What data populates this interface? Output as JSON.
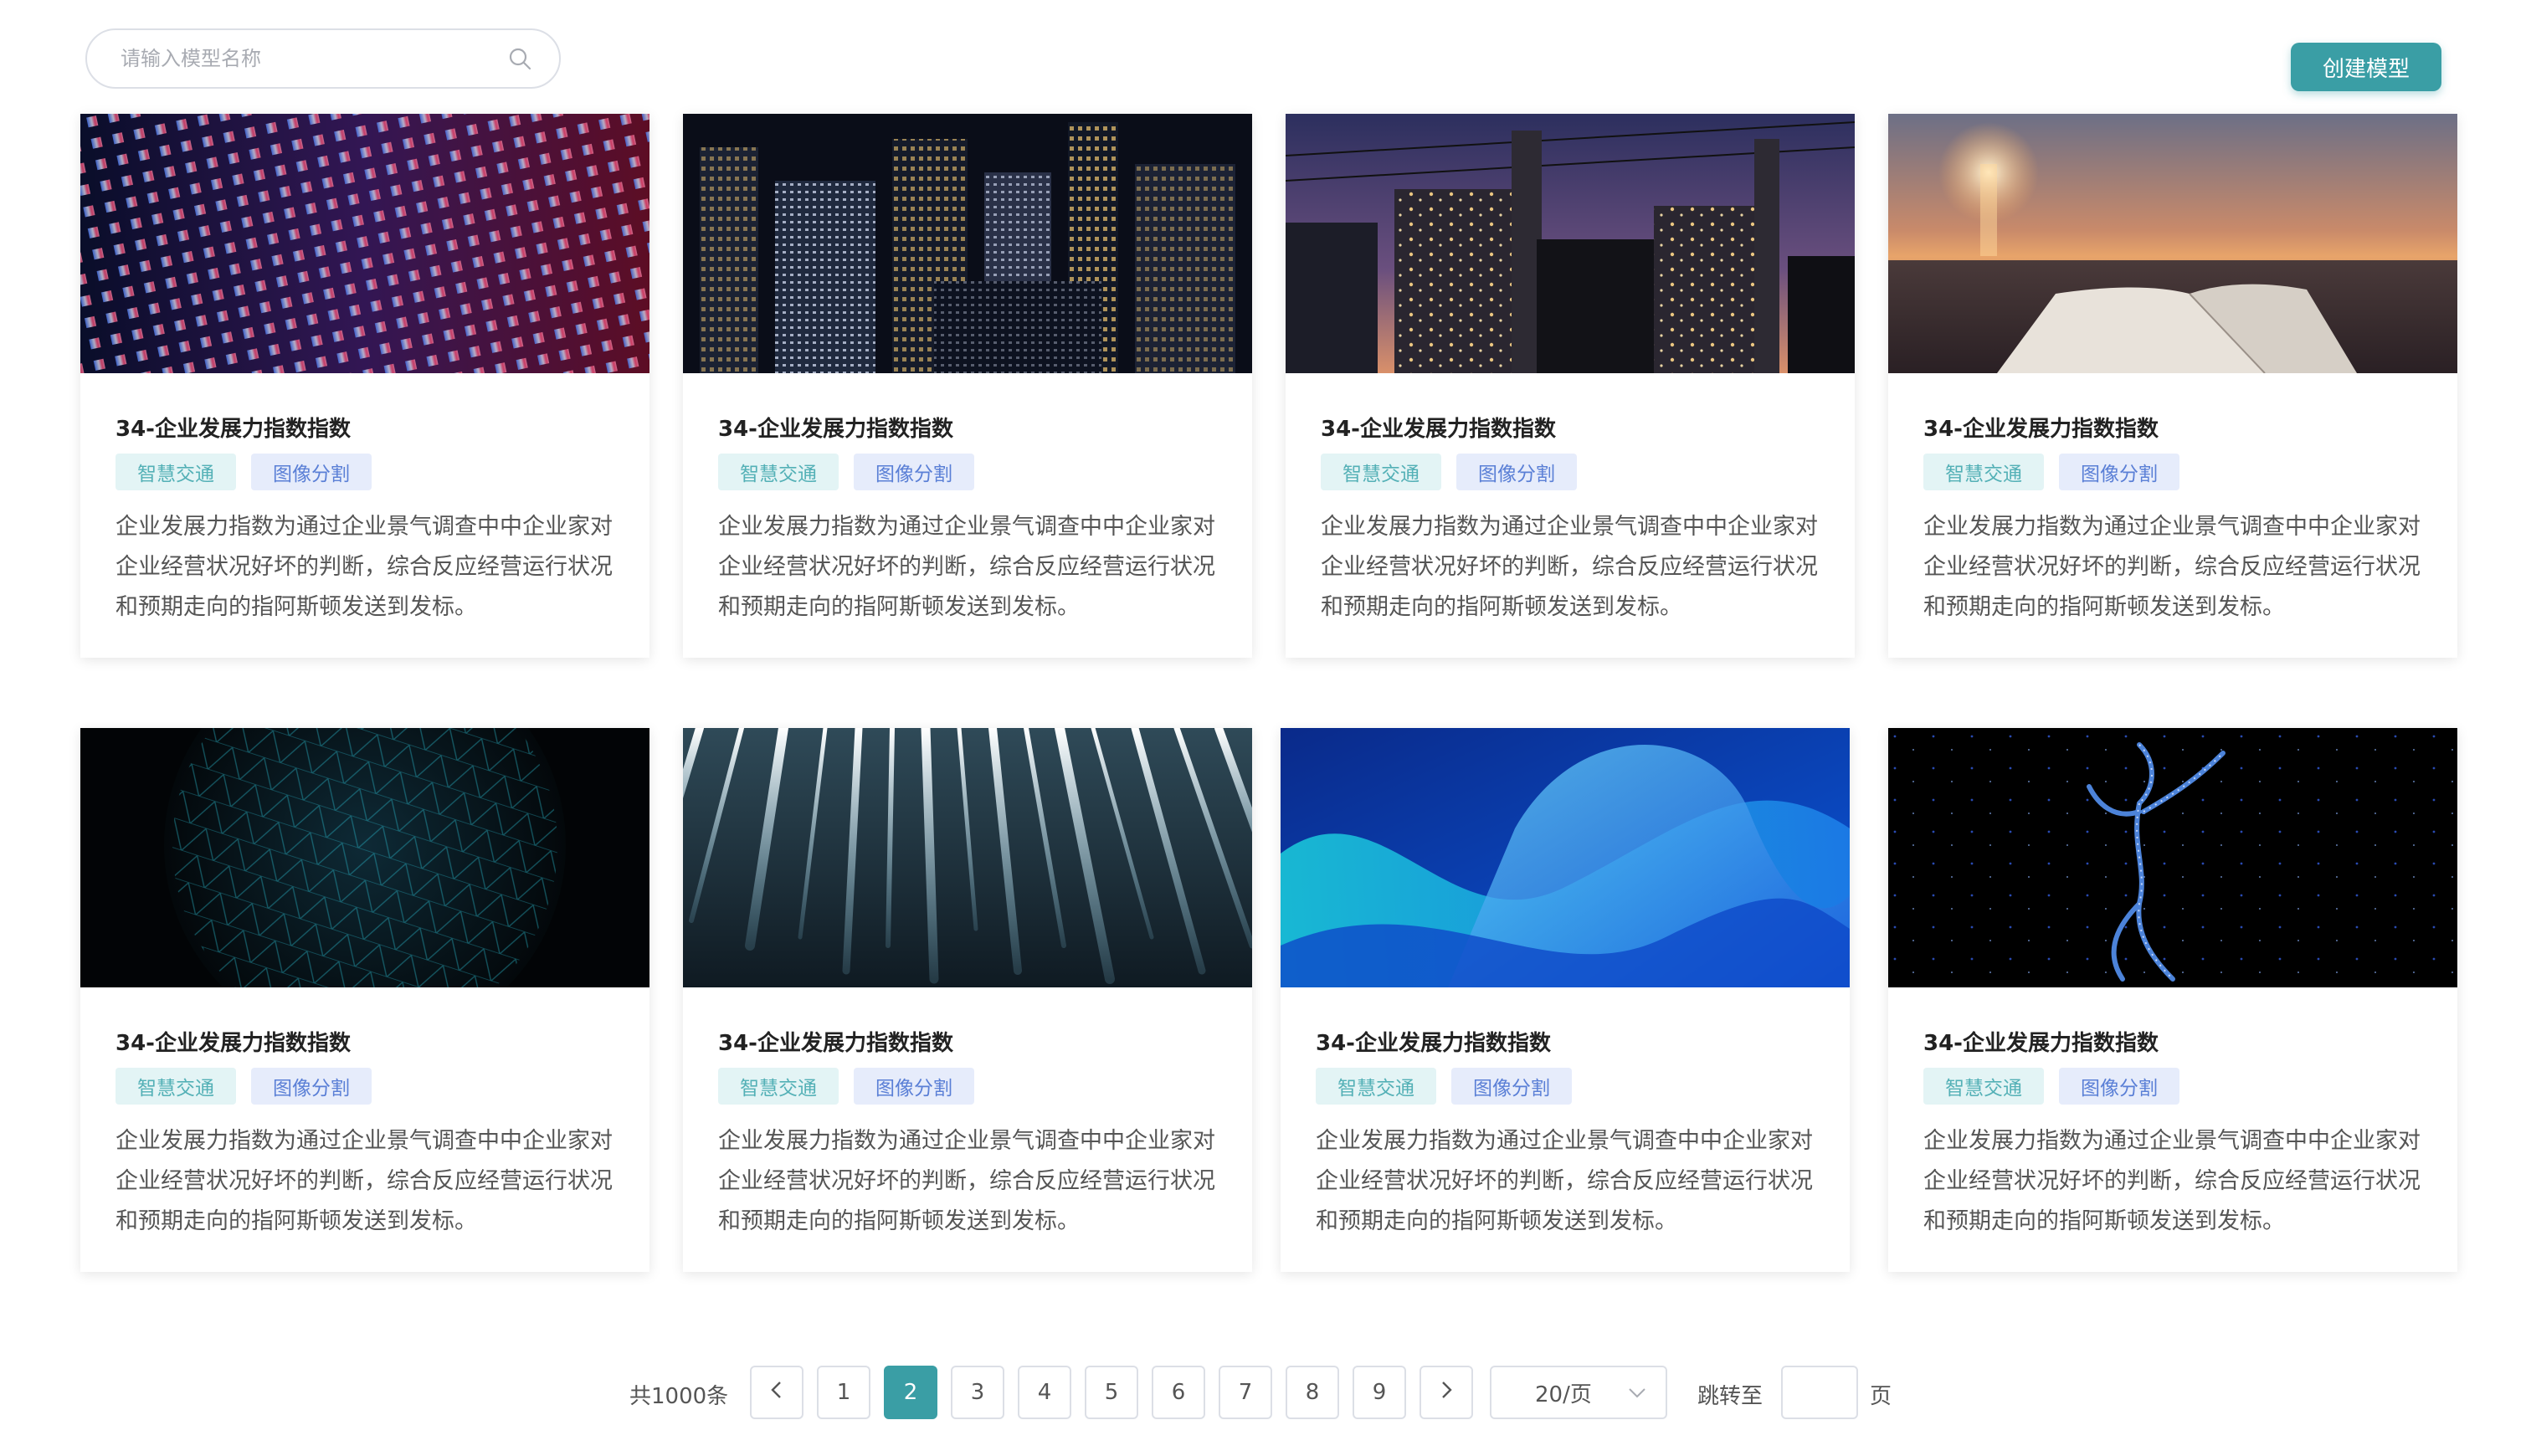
{
  "search": {
    "placeholder": "请输入模型名称",
    "value": "",
    "icon": "search-icon"
  },
  "toolbar": {
    "create_label": "创建模型"
  },
  "cards": [
    {
      "title": "34-企业发展力指数指数",
      "tags": [
        "智慧交通",
        "图像分割"
      ],
      "description": "企业发展力指数为通过企业景气调查中中企业家对企业经营状况好坏的判断，综合反应经营运行状况和预期走向的指阿斯顿发送到发标。",
      "image": "dot-grid-light"
    },
    {
      "title": "34-企业发展力指数指数",
      "tags": [
        "智慧交通",
        "图像分割"
      ],
      "description": "企业发展力指数为通过企业景气调查中中企业家对企业经营状况好坏的判断，综合反应经营运行状况和预期走向的指阿斯顿发送到发标。",
      "image": "city-night"
    },
    {
      "title": "34-企业发展力指数指数",
      "tags": [
        "智慧交通",
        "图像分割"
      ],
      "description": "企业发展力指数为通过企业景气调查中中企业家对企业经营状况好坏的判断，综合反应经营运行状况和预期走向的指阿斯顿发送到发标。",
      "image": "factory-dusk"
    },
    {
      "title": "34-企业发展力指数指数",
      "tags": [
        "智慧交通",
        "图像分割"
      ],
      "description": "企业发展力指数为通过企业景气调查中中企业家对企业经营状况好坏的判断，综合反应经营运行状况和预期走向的指阿斯顿发送到发标。",
      "image": "sunset-book"
    },
    {
      "title": "34-企业发展力指数指数",
      "tags": [
        "智慧交通",
        "图像分割"
      ],
      "description": "企业发展力指数为通过企业景气调查中中企业家对企业经营状况好坏的判断，综合反应经营运行状况和预期走向的指阿斯顿发送到发标。",
      "image": "dark-network"
    },
    {
      "title": "34-企业发展力指数指数",
      "tags": [
        "智慧交通",
        "图像分割"
      ],
      "description": "企业发展力指数为通过企业景气调查中中企业家对企业经营状况好坏的判断，综合反应经营运行状况和预期走向的指阿斯顿发送到发标。",
      "image": "light-streaks"
    },
    {
      "title": "34-企业发展力指数指数",
      "tags": [
        "智慧交通",
        "图像分割"
      ],
      "description": "企业发展力指数为通过企业景气调查中中企业家对企业经营状况好坏的判断，综合反应经营运行状况和预期走向的指阿斯顿发送到发标。",
      "image": "blue-waves"
    },
    {
      "title": "34-企业发展力指数指数",
      "tags": [
        "智慧交通",
        "图像分割"
      ],
      "description": "企业发展力指数为通过企业景气调查中中企业家对企业经营状况好坏的判断，综合反应经营运行状况和预期走向的指阿斯顿发送到发标。",
      "image": "particle-figure"
    }
  ],
  "pagination": {
    "total": "共1000条",
    "prev_icon": "chevron-left-icon",
    "next_icon": "chevron-right-icon",
    "pages": [
      "1",
      "2",
      "3",
      "4",
      "5",
      "6",
      "7",
      "8",
      "9"
    ],
    "current": "2",
    "page_size": "20/页",
    "jump_label": "跳转至",
    "jump_value": "",
    "page_unit": "页"
  },
  "colors": {
    "accent": "#3a9ea5",
    "tag_teal_bg": "#e3f4f5",
    "tag_teal_text": "#53b0b6",
    "tag_blue_bg": "#e6ecfb",
    "tag_blue_text": "#5a7fd6"
  }
}
